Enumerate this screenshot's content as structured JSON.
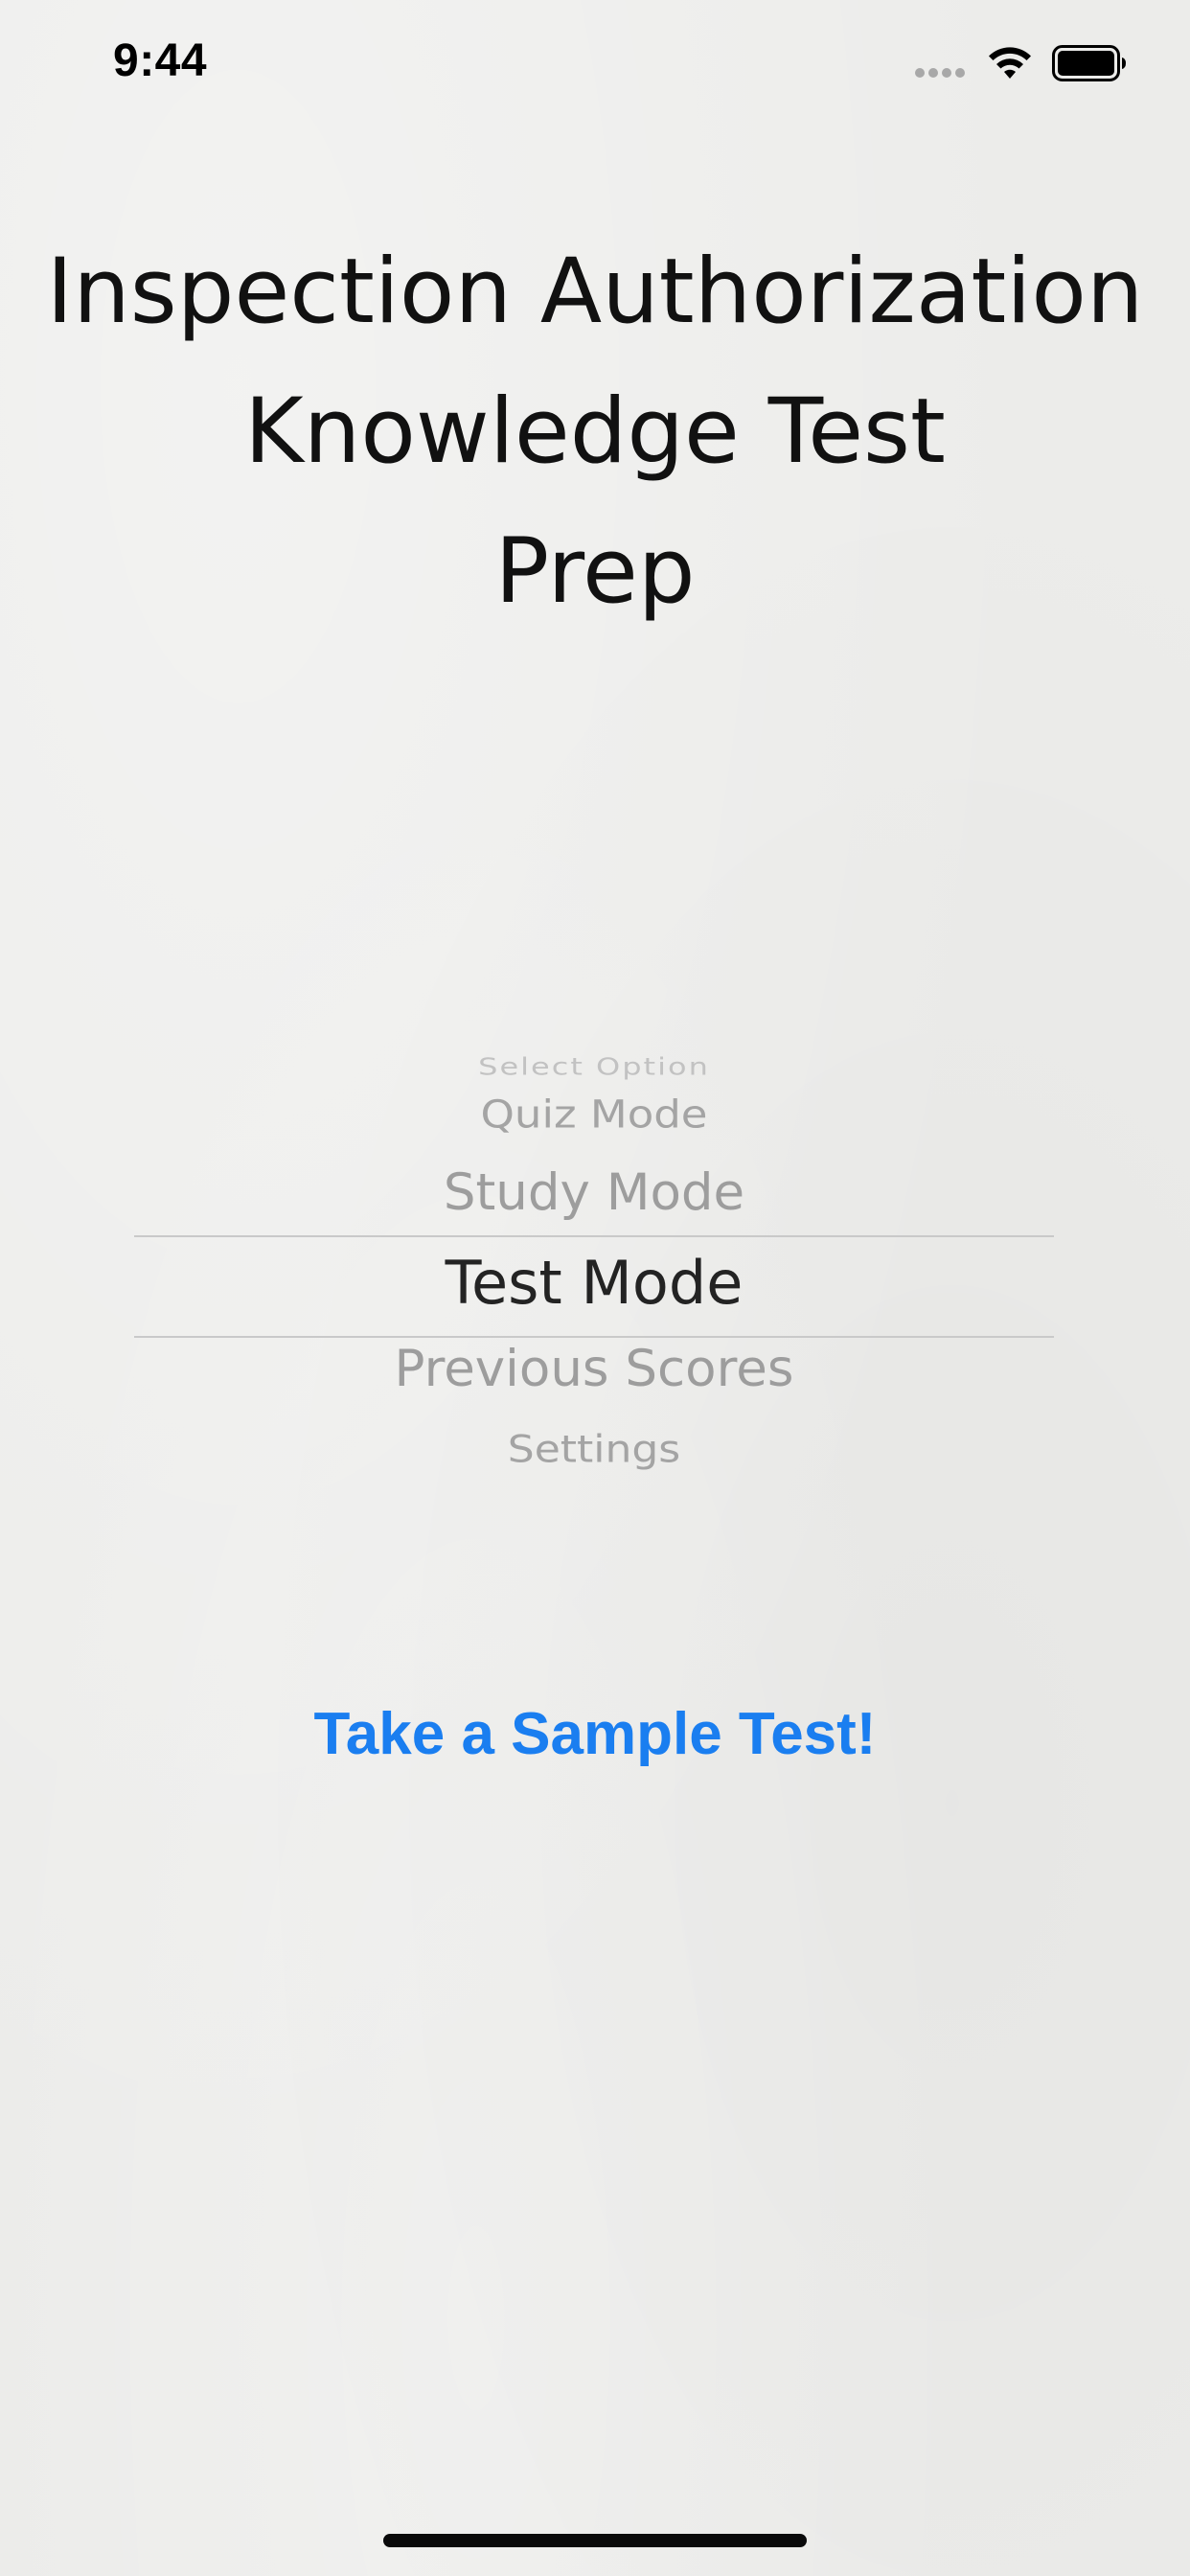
{
  "status_bar": {
    "time": "9:44"
  },
  "title": {
    "line1": "Inspection Authorization",
    "line2": "Knowledge Test",
    "line3": "Prep"
  },
  "picker": {
    "options": [
      "Select Option",
      "Quiz Mode",
      "Study Mode",
      "Test Mode",
      "Previous Scores",
      "Settings"
    ],
    "selected": "Test Mode"
  },
  "sample_button": {
    "label": "Take a Sample Test!"
  },
  "colors": {
    "background": "#ececea",
    "accent": "#1a7ef0",
    "selected_text": "#232323",
    "unselected_text": "#9d9d9d"
  },
  "icons": [
    "signal-dots-icon",
    "wifi-icon",
    "battery-icon"
  ]
}
